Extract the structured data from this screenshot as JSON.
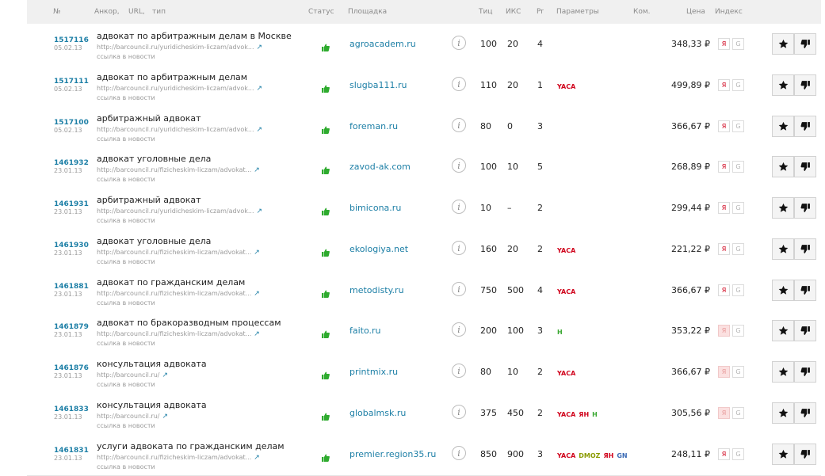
{
  "columns": {
    "num": "№",
    "anchor": "Анкор,",
    "url": "URL,",
    "type": "тип",
    "status": "Статус",
    "site": "Площадка",
    "tic": "Тиц",
    "iks": "ИКС",
    "pr": "Pr",
    "params": "Параметры",
    "comment": "Ком.",
    "price": "Цена",
    "index": "Индекс"
  },
  "colors": {
    "link": "#1d7fa6",
    "yaca": "#d0021b",
    "dmoz": "#8a9a00",
    "yan": "#d0021b",
    "h": "#3aa832",
    "gn": "#3a6ab5",
    "status_ok": "#2eab2e"
  },
  "icons": {
    "status": "thumbs-up-icon",
    "info": "info-icon",
    "external": "external-link-icon",
    "star": "star-icon",
    "dislike": "thumbs-down-icon"
  },
  "index_labels": {
    "yandex": "Я",
    "google": "G"
  },
  "rows": [
    {
      "id": "1517116",
      "date": "05.02.13",
      "anchor": "адвокат по арбитражным делам в Москве",
      "url": "http://barcouncil.ru/yuridicheskim-liczam/advok...",
      "type": "ссылка в новости",
      "site": "agroacadem.ru",
      "tic": "100",
      "iks": "20",
      "pr": "4",
      "params": [],
      "price": "348,33 ₽",
      "yandex_indexed": true
    },
    {
      "id": "1517111",
      "date": "05.02.13",
      "anchor": "адвокат по арбитражным делам",
      "url": "http://barcouncil.ru/yuridicheskim-liczam/advok...",
      "type": "ссылка в новости",
      "site": "slugba111.ru",
      "tic": "110",
      "iks": "20",
      "pr": "1",
      "params": [
        "YACA"
      ],
      "price": "499,89 ₽",
      "yandex_indexed": true
    },
    {
      "id": "1517100",
      "date": "05.02.13",
      "anchor": "арбитражный адвокат",
      "url": "http://barcouncil.ru/yuridicheskim-liczam/advok...",
      "type": "ссылка в новости",
      "site": "foreman.ru",
      "tic": "80",
      "iks": "0",
      "pr": "3",
      "params": [],
      "price": "366,67 ₽",
      "yandex_indexed": true
    },
    {
      "id": "1461932",
      "date": "23.01.13",
      "anchor": "адвокат уголовные дела",
      "url": "http://barcouncil.ru/fizicheskim-liczam/advokat...",
      "type": "ссылка в новости",
      "site": "zavod-ak.com",
      "tic": "100",
      "iks": "10",
      "pr": "5",
      "params": [],
      "price": "268,89 ₽",
      "yandex_indexed": true
    },
    {
      "id": "1461931",
      "date": "23.01.13",
      "anchor": "арбитражный адвокат",
      "url": "http://barcouncil.ru/yuridicheskim-liczam/advok...",
      "type": "ссылка в новости",
      "site": "bimicona.ru",
      "tic": "10",
      "iks": "–",
      "pr": "2",
      "params": [],
      "price": "299,44 ₽",
      "yandex_indexed": true
    },
    {
      "id": "1461930",
      "date": "23.01.13",
      "anchor": "адвокат уголовные дела",
      "url": "http://barcouncil.ru/fizicheskim-liczam/advokat...",
      "type": "ссылка в новости",
      "site": "ekologiya.net",
      "tic": "160",
      "iks": "20",
      "pr": "2",
      "params": [
        "YACA"
      ],
      "price": "221,22 ₽",
      "yandex_indexed": true
    },
    {
      "id": "1461881",
      "date": "23.01.13",
      "anchor": "адвокат по гражданским делам",
      "url": "http://barcouncil.ru/fizicheskim-liczam/advokat...",
      "type": "ссылка в новости",
      "site": "metodisty.ru",
      "tic": "750",
      "iks": "500",
      "pr": "4",
      "params": [
        "YACA"
      ],
      "price": "366,67 ₽",
      "yandex_indexed": true
    },
    {
      "id": "1461879",
      "date": "23.01.13",
      "anchor": "адвокат по бракоразводным процессам",
      "url": "http://barcouncil.ru/fizicheskim-liczam/advokat...",
      "type": "ссылка в новости",
      "site": "faito.ru",
      "tic": "200",
      "iks": "100",
      "pr": "3",
      "params": [
        "H"
      ],
      "price": "353,22 ₽",
      "yandex_indexed": false
    },
    {
      "id": "1461876",
      "date": "23.01.13",
      "anchor": "консультация адвоката",
      "url": "http://barcouncil.ru/",
      "type": "ссылка в новости",
      "site": "printmix.ru",
      "tic": "80",
      "iks": "10",
      "pr": "2",
      "params": [
        "YACA"
      ],
      "price": "366,67 ₽",
      "yandex_indexed": false
    },
    {
      "id": "1461833",
      "date": "23.01.13",
      "anchor": "консультация адвоката",
      "url": "http://barcouncil.ru/",
      "type": "ссылка в новости",
      "site": "globalmsk.ru",
      "tic": "375",
      "iks": "450",
      "pr": "2",
      "params": [
        "YACA",
        "ЯН",
        "H"
      ],
      "price": "305,56 ₽",
      "yandex_indexed": false
    },
    {
      "id": "1461831",
      "date": "23.01.13",
      "anchor": "услуги адвоката по гражданским делам",
      "url": "http://barcouncil.ru/fizicheskim-liczam/advokat...",
      "type": "ссылка в новости",
      "site": "premier.region35.ru",
      "tic": "850",
      "iks": "900",
      "pr": "3",
      "params": [
        "YACA",
        "DMOZ",
        "ЯН",
        "GN"
      ],
      "price": "248,11 ₽",
      "yandex_indexed": true
    }
  ]
}
